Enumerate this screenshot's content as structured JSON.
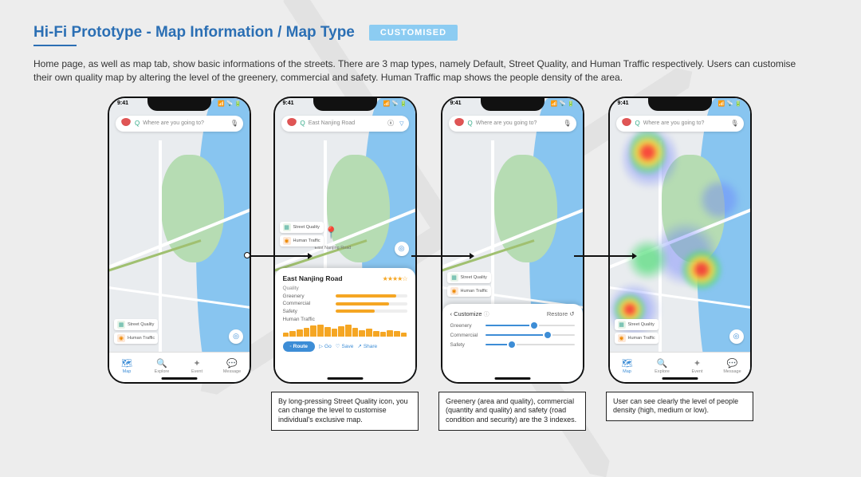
{
  "header": {
    "title": "Hi-Fi Prototype - Map Information / Map Type",
    "badge": "CUSTOMISED"
  },
  "description": "Home page, as well as map tab, show basic informations of the streets. There are 3 map types, namely Default, Street Quality, and Human Traffic respectively. Users can customise their own quality map by altering the level of the greenery, commercial and safety. Human Traffic map shows the people density of the area.",
  "phone": {
    "time": "9:41",
    "search_placeholder": "Where are you going to?",
    "search_value_s2": "East Nanjing Road"
  },
  "nav": {
    "map": "Map",
    "explore": "Explore",
    "event": "Event",
    "message": "Message"
  },
  "chips": {
    "street_quality": "Street Quality",
    "human_traffic": "Human Traffic"
  },
  "info_panel": {
    "road_label": "East Nanjing Road",
    "title": "East Nanjing Road",
    "quality_label": "Quality",
    "metrics": {
      "greenery": "Greenery",
      "commercial": "Commercial",
      "safety": "Safety"
    },
    "human_traffic_label": "Human Traffic",
    "route": "Route",
    "go": "Go",
    "save": "Save",
    "share": "Share"
  },
  "customize": {
    "back": "Customize",
    "restore": "Restore",
    "greenery": "Greenery",
    "commercial": "Commercial",
    "safety": "Safety"
  },
  "captions": {
    "c2": "By long-pressing Street Quality icon, you can change the level to customise individual's exclusive map.",
    "c3": "Greenery (area and quality), commercial (quantity and quality) and safety (road condition and security) are the 3 indexes.",
    "c4": "User can see clearly the level of people density (high, medium or low)."
  },
  "chart_data": {
    "type": "bar",
    "title": "Street Quality metrics (relative index 0–100)",
    "categories": [
      "Greenery",
      "Commercial",
      "Safety"
    ],
    "values": [
      85,
      75,
      55
    ],
    "ylim": [
      0,
      100
    ],
    "customize_sliders": {
      "Greenery": 55,
      "Commercial": 70,
      "Safety": 30
    },
    "rating_stars": 4
  }
}
